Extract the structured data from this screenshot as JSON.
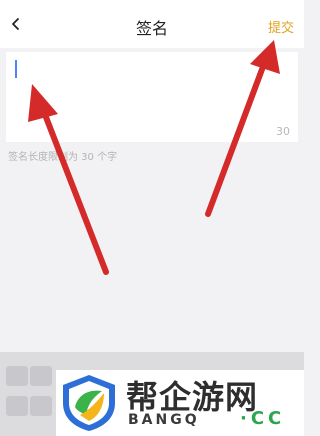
{
  "header": {
    "back_icon": "chevron-left-icon",
    "title": "签名",
    "submit_label": "提交"
  },
  "editor": {
    "value": "",
    "counter": "30"
  },
  "hint": "签名长度限制为 30 个字",
  "colors": {
    "accent": "#e3a21c",
    "caret": "#4a86f7",
    "annotation_arrow": "#d42a2a"
  },
  "watermark": {
    "text_cn": "帮企游网",
    "text_en": "BANGQ",
    "text_cc": "·CC"
  }
}
